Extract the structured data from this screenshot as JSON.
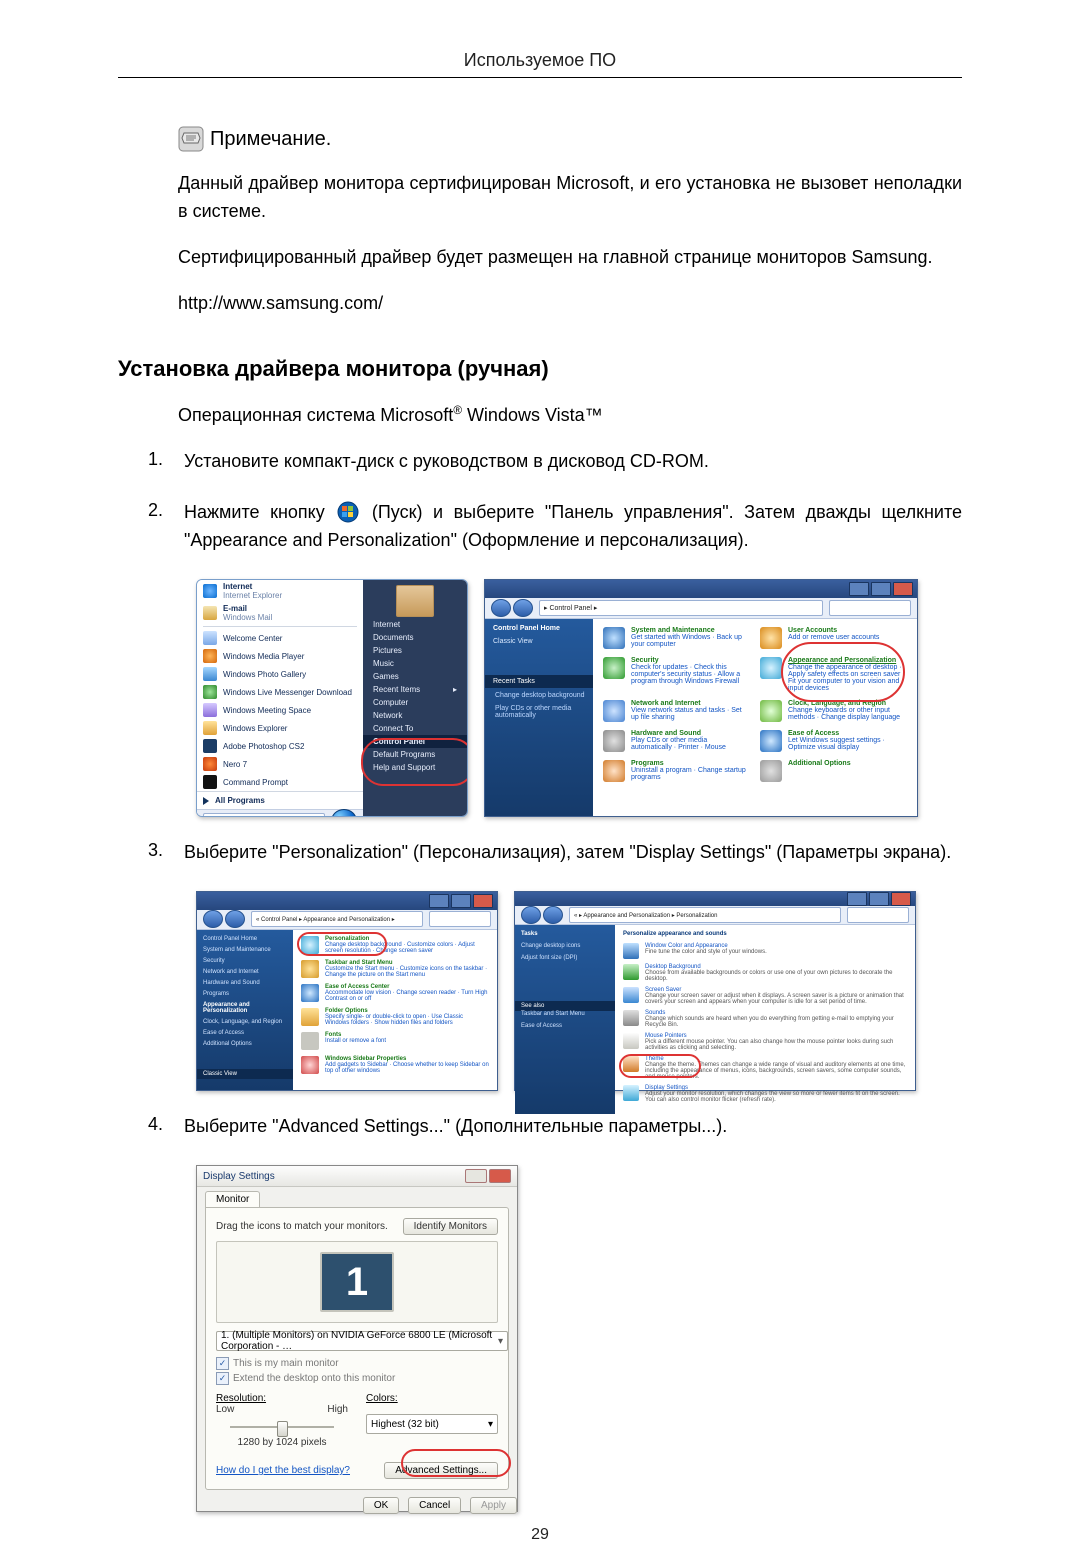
{
  "page": {
    "header": "Используемое ПО",
    "number": "29"
  },
  "note": {
    "label": "Примечание",
    "period": ".",
    "para1": "Данный драйвер монитора сертифицирован Microsoft, и его установка не вызовет неполадки в системе.",
    "para2": "Сертифицированный драйвер будет размещен на главной странице мониторов Samsung.",
    "url": "http://www.samsung.com/"
  },
  "section": {
    "heading": "Установка драйвера монитора (ручная)",
    "os_before_sup": "Операционная система Microsoft",
    "os_sup": "®",
    "os_after_sup": " Windows Vista™"
  },
  "steps": {
    "s1": {
      "n": "1.",
      "t": "Установите компакт-диск с руководством в дисковод CD-ROM."
    },
    "s2": {
      "n": "2.",
      "pre": "Нажмите кнопку ",
      "mid": "(Пуск) и выберите \"Панель управления\". Затем дважды щелкните \"Appearance and Personalization\" (Оформление и персонализация)."
    },
    "s3": {
      "n": "3.",
      "t": "Выберите \"Personalization\" (Персонализация), затем \"Display Settings\" (Параметры экрана)."
    },
    "s4": {
      "n": "4.",
      "t": "Выберите \"Advanced Settings...\" (Дополнительные параметры...)."
    }
  },
  "startmenu": {
    "items": [
      "Internet",
      "E-mail",
      "Welcome Center",
      "Windows Media Player",
      "Windows Photo Gallery",
      "Windows Live Messenger Download",
      "Windows Meeting Space",
      "Windows Explorer",
      "Adobe Photoshop CS2",
      "Nero 7",
      "Command Prompt"
    ],
    "subs": {
      "0": "Internet Explorer",
      "1": "Windows Mail"
    },
    "all": "All Programs",
    "right": {
      "items": [
        "Internet",
        "Documents",
        "Pictures",
        "Music",
        "Games",
        "Recent Items",
        "Computer",
        "Network",
        "Connect To",
        "Control Panel",
        "Default Programs",
        "Help and Support"
      ]
    }
  },
  "cpcat": {
    "addr": "▸ Control Panel ▸",
    "side": {
      "home": "Control Panel Home",
      "view": "Classic View",
      "recent_hd": "Recent Tasks",
      "recent1": "Change desktop background",
      "recent2": "Play CDs or other media automatically"
    },
    "cells": {
      "0": {
        "t": "System and Maintenance",
        "s": "Get started with Windows · Back up your computer"
      },
      "1": {
        "t": "User Accounts",
        "s": "Add or remove user accounts"
      },
      "2": {
        "t": "Security",
        "s": "Check for updates · Check this computer's security status · Allow a program through Windows Firewall"
      },
      "3": {
        "t": "Appearance and Personalization",
        "s": "Change the appearance of desktop · Apply safety effects on screen saver · Fit your computer to your vision and input devices"
      },
      "4": {
        "t": "Network and Internet",
        "s": "View network status and tasks · Set up file sharing"
      },
      "5": {
        "t": "Clock, Language, and Region",
        "s": "Change keyboards or other input methods · Change display language"
      },
      "6": {
        "t": "Hardware and Sound",
        "s": "Play CDs or other media automatically · Printer · Mouse"
      },
      "7": {
        "t": "Ease of Access",
        "s": "Let Windows suggest settings · Optimize visual display"
      },
      "8": {
        "t": "Programs",
        "s": "Uninstall a program · Change startup programs"
      },
      "9": {
        "t": "Additional Options",
        "s": ""
      }
    }
  },
  "appear": {
    "addr": "« Control Panel ▸ Appearance and Personalization ▸",
    "side": {
      "home": "Control Panel Home",
      "i0": "System and Maintenance",
      "i1": "Security",
      "i2": "Network and Internet",
      "i3": "Hardware and Sound",
      "i4": "Programs",
      "i5": "Appearance and Personalization",
      "i6": "Clock, Language, and Region",
      "i7": "Ease of Access",
      "i8": "Additional Options",
      "see": "Classic View"
    },
    "rows": {
      "0": {
        "t": "Personalization",
        "s": "Change desktop background · Customize colors · Adjust screen resolution · Change screen saver"
      },
      "1": {
        "t": "Taskbar and Start Menu",
        "s": "Customize the Start menu · Customize icons on the taskbar · Change the picture on the Start menu"
      },
      "2": {
        "t": "Ease of Access Center",
        "s": "Accommodate low vision · Change screen reader · Turn High Contrast on or off"
      },
      "3": {
        "t": "Folder Options",
        "s": "Specify single- or double-click to open · Use Classic Windows folders · Show hidden files and folders"
      },
      "4": {
        "t": "Fonts",
        "s": "Install or remove a font"
      },
      "5": {
        "t": "Windows Sidebar Properties",
        "s": "Add gadgets to Sidebar · Choose whether to keep Sidebar on top of other windows"
      }
    }
  },
  "person": {
    "addr": "« ▸ Appearance and Personalization ▸ Personalization",
    "head": "Personalize appearance and sounds",
    "side": {
      "t0": "Tasks",
      "t1": "Change desktop icons",
      "t2": "Adjust font size (DPI)",
      "see": "See also",
      "s1": "Taskbar and Start Menu",
      "s2": "Ease of Access"
    },
    "rows": {
      "0": {
        "t": "Window Color and Appearance",
        "d": "Fine tune the color and style of your windows."
      },
      "1": {
        "t": "Desktop Background",
        "d": "Choose from available backgrounds or colors or use one of your own pictures to decorate the desktop."
      },
      "2": {
        "t": "Screen Saver",
        "d": "Change your screen saver or adjust when it displays. A screen saver is a picture or animation that covers your screen and appears when your computer is idle for a set period of time."
      },
      "3": {
        "t": "Sounds",
        "d": "Change which sounds are heard when you do everything from getting e-mail to emptying your Recycle Bin."
      },
      "4": {
        "t": "Mouse Pointers",
        "d": "Pick a different mouse pointer. You can also change how the mouse pointer looks during such activities as clicking and selecting."
      },
      "5": {
        "t": "Theme",
        "d": "Change the theme. Themes can change a wide range of visual and auditory elements at one time, including the appearance of menus, icons, backgrounds, screen savers, some computer sounds, and mouse pointers."
      },
      "6": {
        "t": "Display Settings",
        "d": "Adjust your monitor resolution, which changes the view so more or fewer items fit on the screen. You can also control monitor flicker (refresh rate)."
      }
    }
  },
  "display": {
    "title": "Display Settings",
    "tab": "Monitor",
    "drag": "Drag the icons to match your monitors.",
    "identify": "Identify Monitors",
    "mon": "1",
    "select": "1. (Multiple Monitors) on NVIDIA GeForce 6800 LE (Microsoft Corporation - …",
    "chk1": "This is my main monitor",
    "chk2": "Extend the desktop onto this monitor",
    "resLabel": "Resolution:",
    "low": "Low",
    "high": "High",
    "resVal": "1280 by 1024 pixels",
    "colLabel": "Colors:",
    "colVal": "Highest (32 bit)",
    "help": "How do I get the best display?",
    "adv": "Advanced Settings...",
    "ok": "OK",
    "cancel": "Cancel",
    "apply": "Apply"
  }
}
